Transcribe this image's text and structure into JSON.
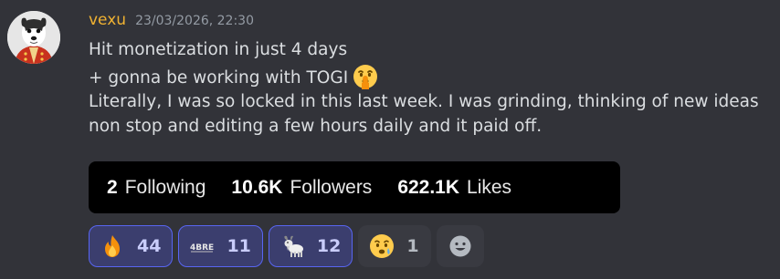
{
  "message": {
    "username": "vexu",
    "timestamp": "23/03/2026, 22:30",
    "lines": [
      "Hit monetization in just 4 days",
      "+ gonna be working with TOGI",
      "Literally, I was so locked in this last week. I was grinding, thinking of new ideas non stop and editing a few hours daily and it paid off."
    ],
    "inline_emoji": "shushing-face-emoji"
  },
  "stats": {
    "following_count": "2",
    "following_label": "Following",
    "followers_count": "10.6K",
    "followers_label": "Followers",
    "likes_count": "622.1K",
    "likes_label": "Likes"
  },
  "reactions": [
    {
      "icon": "fire-emoji",
      "count": "44",
      "me": true
    },
    {
      "icon": "custom-emoji-4bre",
      "count": "11",
      "me": true
    },
    {
      "icon": "goat-emoji",
      "count": "12",
      "me": true
    },
    {
      "icon": "crying-face-emoji",
      "count": "1",
      "me": false
    }
  ],
  "colors": {
    "background": "#323339",
    "username": "#f0b232",
    "timestamp": "#949ba4",
    "reaction_active_bg": "#3b3e6e",
    "reaction_active_border": "#5865f2"
  }
}
